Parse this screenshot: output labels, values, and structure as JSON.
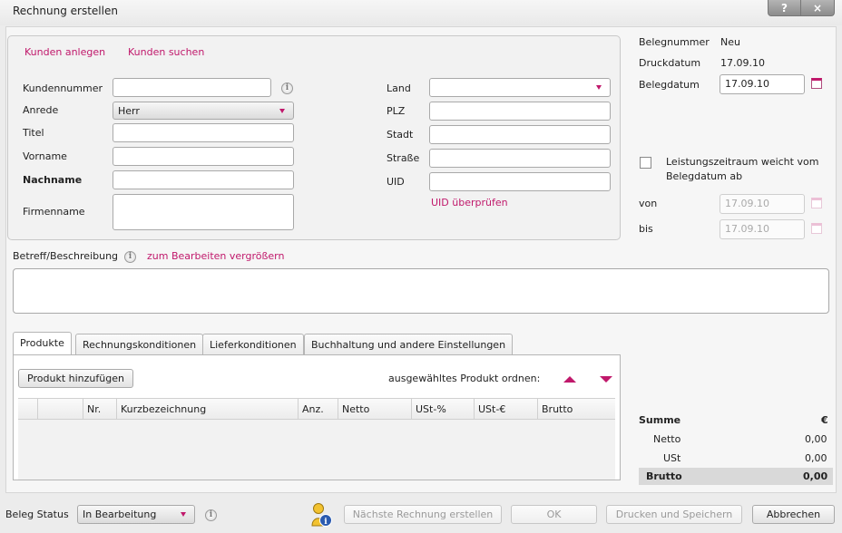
{
  "window": {
    "title": "Rechnung erstellen",
    "help_label": "?",
    "close_label": "×"
  },
  "customer": {
    "create_link": "Kunden anlegen",
    "search_link": "Kunden suchen",
    "fields": {
      "kundennummer": {
        "label": "Kundennummer",
        "value": ""
      },
      "anrede": {
        "label": "Anrede",
        "value": "Herr"
      },
      "titel": {
        "label": "Titel",
        "value": ""
      },
      "vorname": {
        "label": "Vorname",
        "value": ""
      },
      "nachname": {
        "label": "Nachname",
        "value": ""
      },
      "firmenname": {
        "label": "Firmenname",
        "value": ""
      },
      "land": {
        "label": "Land",
        "value": ""
      },
      "plz": {
        "label": "PLZ",
        "value": ""
      },
      "stadt": {
        "label": "Stadt",
        "value": ""
      },
      "strasse": {
        "label": "Straße",
        "value": ""
      },
      "uid": {
        "label": "UID",
        "value": ""
      }
    },
    "uid_check_link": "UID überprüfen"
  },
  "document": {
    "belegnummer_label": "Belegnummer",
    "belegnummer_value": "Neu",
    "druckdatum_label": "Druckdatum",
    "druckdatum_value": "17.09.10",
    "belegdatum_label": "Belegdatum",
    "belegdatum_value": "17.09.10",
    "period_checkbox_label_1": "Leistungszeitraum weicht vom",
    "period_checkbox_label_2": "Belegdatum ab",
    "period_checked": false,
    "von_label": "von",
    "von_value": "17.09.10",
    "bis_label": "bis",
    "bis_value": "17.09.10"
  },
  "description": {
    "label": "Betreff/Beschreibung",
    "enlarge_link": "zum Bearbeiten vergrößern",
    "value": ""
  },
  "tabs": [
    {
      "label": "Produkte",
      "active": true
    },
    {
      "label": "Rechnungskonditionen",
      "active": false
    },
    {
      "label": "Lieferkonditionen",
      "active": false
    },
    {
      "label": "Buchhaltung und andere Einstellungen",
      "active": false
    }
  ],
  "products": {
    "add_button": "Produkt hinzufügen",
    "order_label": "ausgewähltes Produkt ordnen:",
    "columns": [
      "Nr.",
      "Kurzbezeichnung",
      "Anz.",
      "Netto",
      "USt-%",
      "USt-€",
      "Brutto"
    ],
    "rows": []
  },
  "summary": {
    "title": "Summe",
    "currency": "€",
    "netto_label": "Netto",
    "netto_value": "0,00",
    "ust_label": "USt",
    "ust_value": "0,00",
    "brutto_label": "Brutto",
    "brutto_value": "0,00"
  },
  "footer": {
    "status_label": "Beleg Status",
    "status_value": "In Bearbeitung",
    "next_invoice_button": "Nächste Rechnung erstellen",
    "ok_button": "OK",
    "print_save_button": "Drucken und Speichern",
    "cancel_button": "Abbrechen"
  },
  "colors": {
    "accent": "#c0186b",
    "background": "#ececec"
  }
}
